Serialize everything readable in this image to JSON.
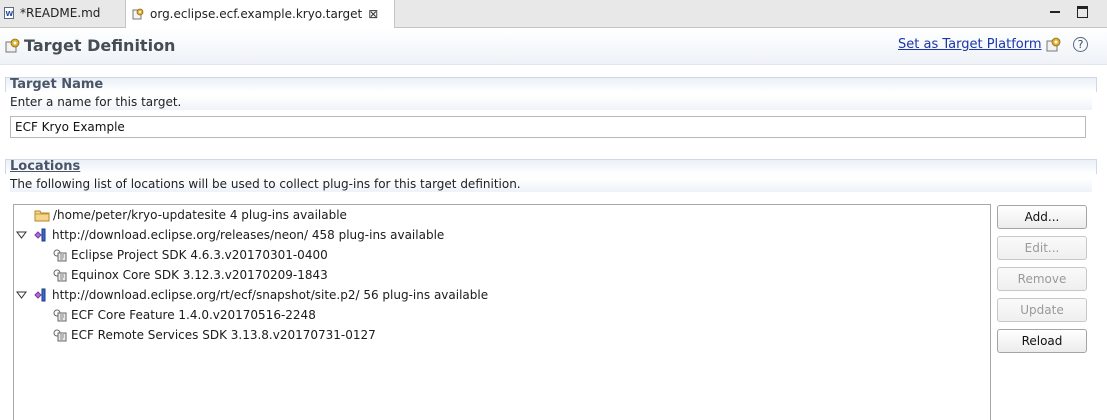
{
  "tabs": [
    {
      "label": "*README.md",
      "icon": "markdown-file-icon"
    },
    {
      "label": "org.eclipse.ecf.example.kryo.target",
      "icon": "target-file-icon",
      "close": "⊠"
    }
  ],
  "editor": {
    "title": "Target Definition",
    "set_target_link": "Set as Target Platform",
    "help_icon": "?"
  },
  "target_name": {
    "section_title": "Target Name",
    "description": "Enter a name for this target.",
    "value": "ECF Kryo Example"
  },
  "locations": {
    "section_title": "Locations",
    "description": "The following list of locations will be used to collect plug-ins for this target definition.",
    "items": [
      {
        "label": "/home/peter/kryo-updatesite 4 plug-ins available",
        "icon": "folder-icon",
        "level": 0,
        "expanded": null
      },
      {
        "label": "http://download.eclipse.org/releases/neon/ 458 plug-ins available",
        "icon": "software-site-icon",
        "level": 0,
        "expanded": true
      },
      {
        "label": "Eclipse Project SDK 4.6.3.v20170301-0400",
        "icon": "feature-icon",
        "level": 1
      },
      {
        "label": "Equinox Core SDK 3.12.3.v20170209-1843",
        "icon": "feature-icon",
        "level": 1
      },
      {
        "label": "http://download.eclipse.org/rt/ecf/snapshot/site.p2/ 56 plug-ins available",
        "icon": "software-site-icon",
        "level": 0,
        "expanded": true
      },
      {
        "label": "ECF Core Feature 1.4.0.v20170516-2248",
        "icon": "feature-icon",
        "level": 1
      },
      {
        "label": "ECF Remote Services SDK 3.13.8.v20170731-0127",
        "icon": "feature-icon",
        "level": 1
      }
    ],
    "buttons": {
      "add": "Add...",
      "edit": "Edit...",
      "remove": "Remove",
      "update": "Update",
      "reload": "Reload"
    }
  }
}
